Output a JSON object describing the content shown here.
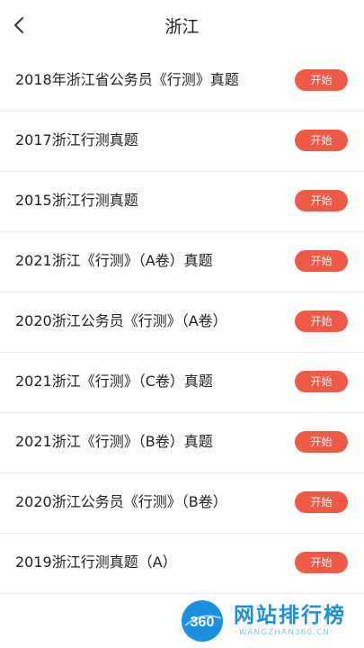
{
  "header": {
    "title": "浙江",
    "back_icon": "chevron-left-icon"
  },
  "exams": [
    {
      "title": "2018年浙江省公务员《行测》真题",
      "action": "开始"
    },
    {
      "title": "2017浙江行测真题",
      "action": "开始"
    },
    {
      "title": "2015浙江行测真题",
      "action": "开始"
    },
    {
      "title": "2021浙江《行测》（A卷）真题",
      "action": "开始"
    },
    {
      "title": "2020浙江公务员《行测》（A卷）",
      "action": "开始"
    },
    {
      "title": "2021浙江《行测》（C卷）真题",
      "action": "开始"
    },
    {
      "title": "2021浙江《行测》（B卷）真题",
      "action": "开始"
    },
    {
      "title": "2020浙江公务员《行测》（B卷）",
      "action": "开始"
    },
    {
      "title": "2019浙江行测真题（A）",
      "action": "开始"
    }
  ],
  "watermark": {
    "logo_text": "360",
    "brand": "网站排行榜",
    "url": "·WANGZHAN360.CN·"
  },
  "colors": {
    "accent": "#ee5a45",
    "watermark_blue": "#1b8fe0"
  }
}
